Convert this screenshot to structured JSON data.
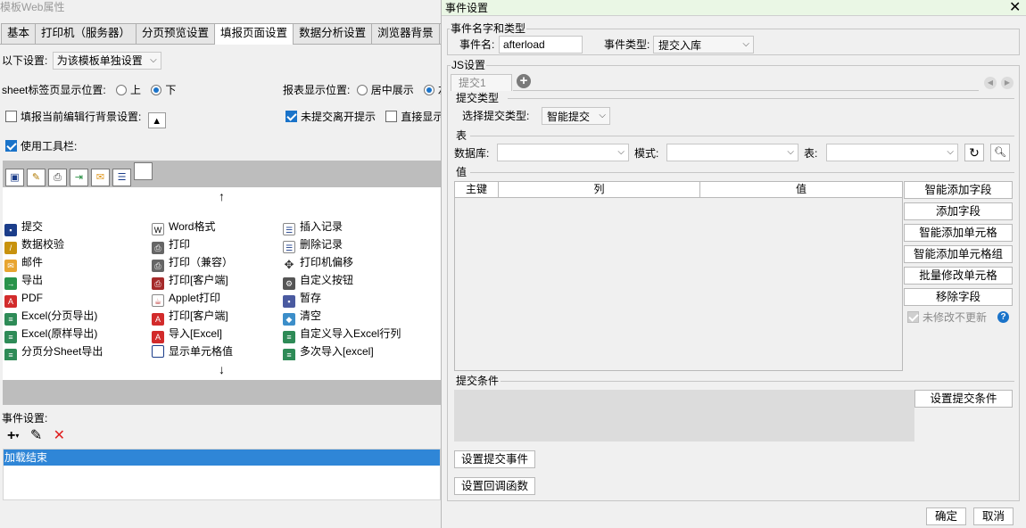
{
  "window": {
    "title": "模板Web属性"
  },
  "tabs": [
    "基本",
    "打印机（服务器）",
    "分页预览设置",
    "填报页面设置",
    "数据分析设置",
    "浏览器背景",
    "引"
  ],
  "settings": {
    "scope_label": "以下设置:",
    "scope_value": "为该模板单独设置",
    "sheet_pos_label": "sheet标签页显示位置:",
    "top_label": "上",
    "bottom_label": "下",
    "report_pos_label": "报表显示位置:",
    "center_label": "居中展示",
    "left_label": "左",
    "bg_label": "填报当前编辑行背景设置:",
    "unsubmit_label": "未提交离开提示",
    "direct_label": "直接显示",
    "toolbar_label": "使用工具栏:"
  },
  "buttons_list": {
    "col1": [
      "提交",
      "数据校验",
      "邮件",
      "导出",
      "PDF",
      "Excel(分页导出)",
      "Excel(原样导出)",
      "分页分Sheet导出"
    ],
    "col2": [
      "Word格式",
      "打印",
      "打印（兼容）",
      "打印[客户端]",
      "Applet打印",
      "打印[客户端]",
      "导入[Excel]",
      "显示单元格值"
    ],
    "col3": [
      "插入记录",
      "删除记录",
      "打印机偏移",
      "自定义按钮",
      "暂存",
      "清空",
      "自定义导入Excel行列",
      "多次导入[excel]"
    ]
  },
  "events": {
    "label": "事件设置:",
    "selected": "加载结束"
  },
  "dialog": {
    "title": "事件设置",
    "name_type_group": "事件名字和类型",
    "event_name_label": "事件名:",
    "event_name_value": "afterload",
    "event_type_label": "事件类型:",
    "event_type_value": "提交入库",
    "js_group": "JS设置",
    "js_tab": "提交1",
    "submit_type_section": "提交类型",
    "submit_type_label": "选择提交类型:",
    "submit_type_value": "智能提交",
    "table_section": "表",
    "db_label": "数据库:",
    "mode_label": "模式:",
    "table_label": "表:",
    "value_section": "值",
    "col_key": "主键",
    "col_col": "列",
    "col_val": "值",
    "side_buttons": [
      "智能添加字段",
      "添加字段",
      "智能添加单元格",
      "智能添加单元格组",
      "批量修改单元格",
      "移除字段"
    ],
    "no_update_label": "未修改不更新",
    "cond_section": "提交条件",
    "cond_button": "设置提交条件",
    "submit_event_button": "设置提交事件",
    "callback_button": "设置回调函数",
    "ok": "确定",
    "cancel": "取消"
  }
}
